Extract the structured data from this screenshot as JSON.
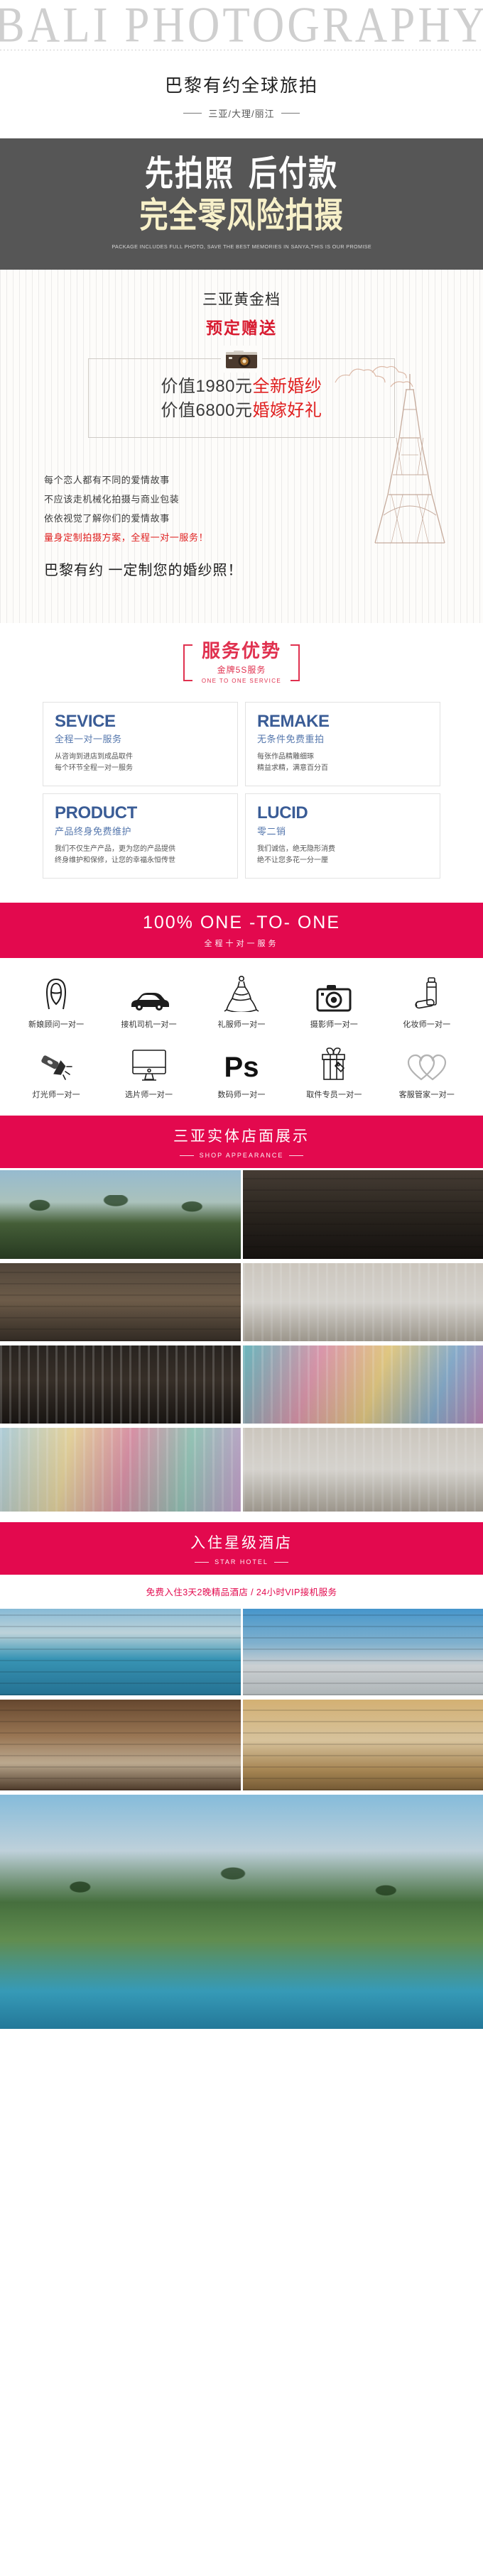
{
  "masthead": {
    "wordmark": "BALI PHOTOGRAPHY"
  },
  "title": {
    "main": "巴黎有约全球旅拍",
    "sub": "三亚/大理/丽江"
  },
  "hero": {
    "line1_a": "先拍照",
    "line1_b": "后付款",
    "line2": "完全零风险拍摄",
    "english": "PACKAGE INCLUDES FULL PHOTO, SAVE THE BEST MEMORIES IN SANYA,THIS IS  OUR PROMISE",
    "bg_color": "#565656",
    "line2_color": "#f7f0c9"
  },
  "gift": {
    "heading": "三亚黄金档",
    "subheading": "预定赠送",
    "camera_icon": "camera-icon",
    "price_lines": [
      {
        "grey": "价值1980元",
        "red": "全新婚纱"
      },
      {
        "grey": "价值6800元",
        "red": "婚嫁好礼"
      }
    ]
  },
  "story": {
    "lines": [
      {
        "text": "每个恋人都有不同的爱情故事",
        "red": false
      },
      {
        "text": "不应该走机械化拍摄与商业包装",
        "red": false
      },
      {
        "text": "依依视觉了解你们的爱情故事",
        "red": false
      },
      {
        "text": "量身定制拍摄方案，全程一对一服务！",
        "red": true
      }
    ],
    "tagline": "巴黎有约 一定制您的婚纱照！"
  },
  "advantage": {
    "title": "服务优势",
    "subtitle": "金牌5S服务",
    "english": "ONE TO ONE SERVICE",
    "accent": "#e0314f",
    "cards": [
      {
        "en": "SEVICE",
        "cn": "全程一对一服务",
        "d1": "从咨询到进店到成品取件",
        "d2": "每个环节全程一对一服务"
      },
      {
        "en": "REMAKE",
        "cn": "无条件免费重拍",
        "d1": "每张作品精雕细琢",
        "d2": "精益求精，满意百分百"
      },
      {
        "en": "PRODUCT",
        "cn": "产品终身免费维护",
        "d1": "我们不仅生产产品，更为您的产品提供",
        "d2": "终身维护和保修，让您的幸福永恒传世"
      },
      {
        "en": "LUCID",
        "cn": "零二销",
        "d1": "我们诚信，绝无隐形消费",
        "d2": "绝不让您多花一分一厘"
      }
    ]
  },
  "one_to_one": {
    "english": "100% ONE -TO- ONE",
    "chinese": "全程十对一服务",
    "band_color": "#e3094e",
    "row1": [
      {
        "icon": "bride-icon",
        "label": "新娘顾问一对一"
      },
      {
        "icon": "car-icon",
        "label": "接机司机一对一"
      },
      {
        "icon": "gown-icon",
        "label": "礼服师一对一"
      },
      {
        "icon": "camera-icon",
        "label": "摄影师一对一"
      },
      {
        "icon": "makeup-icon",
        "label": "化妆师一对一"
      }
    ],
    "row2": [
      {
        "icon": "flashlight-icon",
        "label": "灯光师一对一"
      },
      {
        "icon": "monitor-icon",
        "label": "选片师一对一"
      },
      {
        "icon": "photoshop-icon",
        "label": "数码师一对一"
      },
      {
        "icon": "gift-icon",
        "label": "取件专员一对一"
      },
      {
        "icon": "hearts-icon",
        "label": "客服管家一对一"
      }
    ]
  },
  "store": {
    "title": "三亚实体店面展示",
    "english": "SHOP APPEARANCE",
    "photos": [
      {
        "name": "storefront-palms-photo",
        "alt": "门店外景棕榈树"
      },
      {
        "name": "store-interior-dark-photo",
        "alt": "店内暗色装潢"
      },
      {
        "name": "store-display-photo",
        "alt": "店内陈列区"
      },
      {
        "name": "dress-rack-white-photo",
        "alt": "白色婚纱陈列架"
      },
      {
        "name": "lounge-sofa-photo",
        "alt": "休息沙发区"
      },
      {
        "name": "dress-rack-color-photo",
        "alt": "彩色礼服陈列架"
      },
      {
        "name": "dress-wall-color-photo",
        "alt": "彩色礼服墙"
      },
      {
        "name": "dress-wall-pastel-photo",
        "alt": "浅色礼服墙"
      }
    ]
  },
  "hotel": {
    "title": "入住星级酒店",
    "english": "STAR HOTEL",
    "note": "免费入住3天2晚精品酒店 / 24小时VIP接机服务",
    "photos": [
      {
        "name": "pool-lounge-photo",
        "alt": "泳池躺椅"
      },
      {
        "name": "hotel-exterior-photo",
        "alt": "酒店外观蓝天"
      },
      {
        "name": "hotel-room-photo",
        "alt": "客房双床"
      },
      {
        "name": "bathroom-photo",
        "alt": "卫浴毛巾"
      },
      {
        "name": "beach-resort-photo",
        "alt": "海滩度假泳池全景"
      }
    ]
  }
}
